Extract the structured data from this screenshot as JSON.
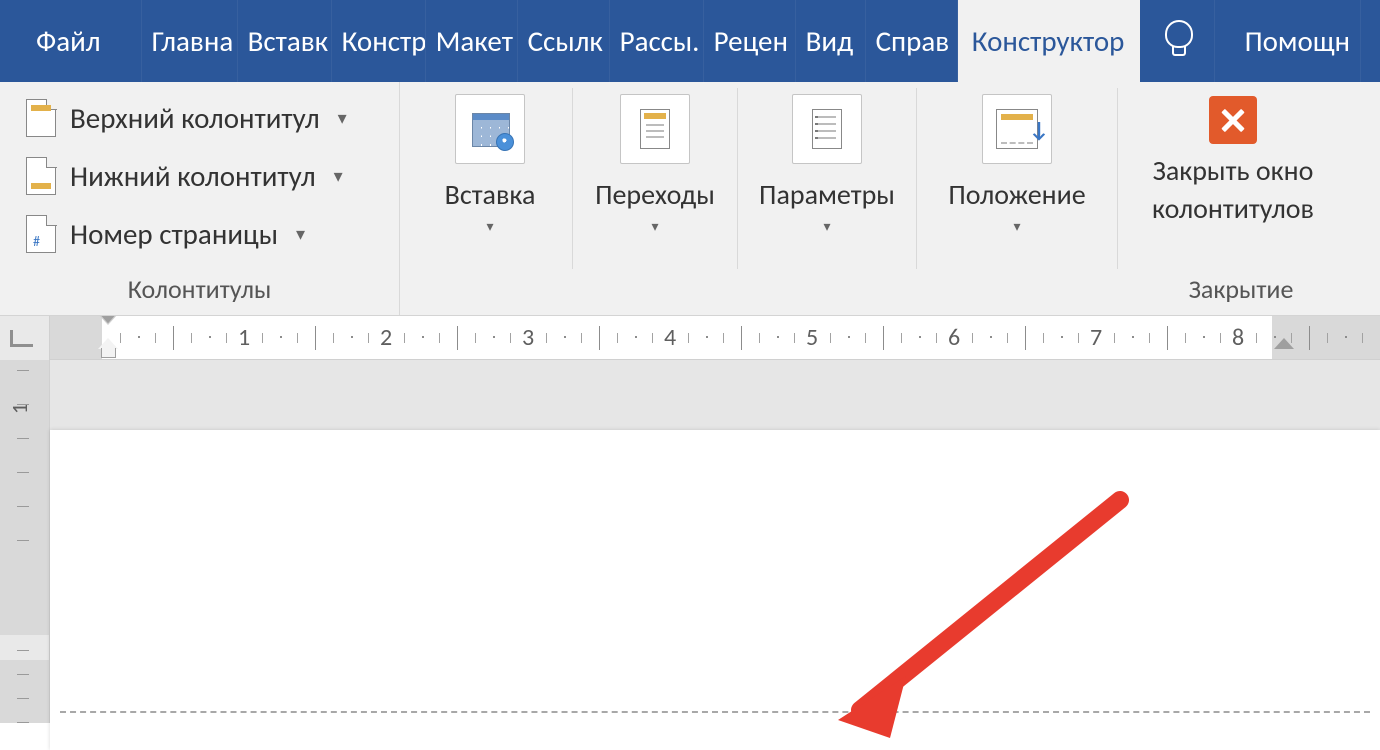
{
  "tabs": {
    "file": "Файл",
    "home": "Главна",
    "insert": "Вставк",
    "design": "Констр",
    "layout": "Макет",
    "references": "Ссылк",
    "mailings": "Рассы.",
    "review": "Рецен",
    "view": "Вид",
    "help": "Справ",
    "active": "Конструктор",
    "assist": "Помощн"
  },
  "hf": {
    "header": "Верхний колонтитул",
    "footer": "Нижний колонтитул",
    "page_number": "Номер страницы",
    "group": "Колонтитулы"
  },
  "btn": {
    "insert": "Вставка",
    "transitions": "Переходы",
    "options": "Параметры",
    "position": "Положение"
  },
  "close": {
    "line1": "Закрыть окно",
    "line2": "колонтитулов",
    "group": "Закрытие"
  },
  "ruler": {
    "h": [
      "1",
      "2",
      "3",
      "4",
      "5",
      "6",
      "7",
      "8"
    ],
    "v": [
      "1"
    ]
  }
}
